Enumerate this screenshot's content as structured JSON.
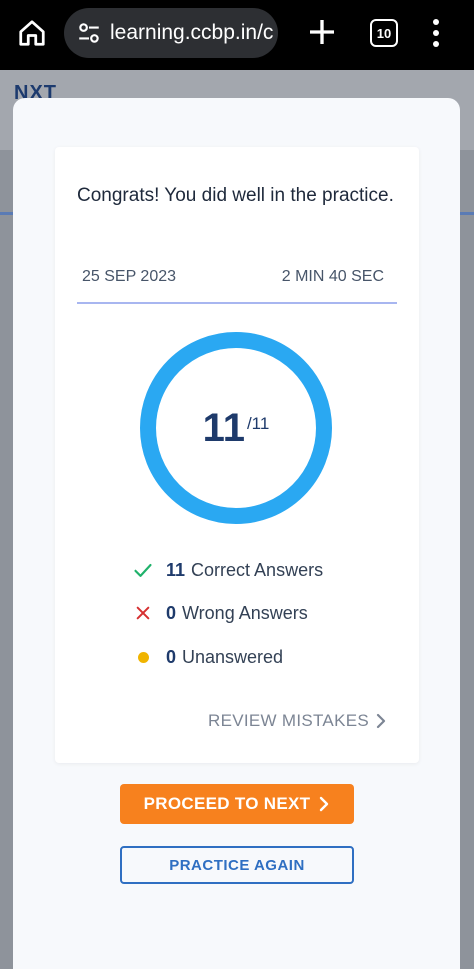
{
  "browser": {
    "url": "learning.ccbp.in/c",
    "tab_count": "10"
  },
  "page": {
    "brand": "NXT"
  },
  "result": {
    "message": "Congrats! You did well in the practice.",
    "date": "25 SEP 2023",
    "duration": "2 MIN 40 SEC",
    "score": "11",
    "total": "/11",
    "score_fraction": 1.0,
    "stats": {
      "correct": {
        "count": "11",
        "label": "Correct Answers"
      },
      "wrong": {
        "count": "0",
        "label": "Wrong Answers"
      },
      "unanswered": {
        "count": "0",
        "label": "Unanswered"
      }
    },
    "review_label": "REVIEW MISTAKES"
  },
  "actions": {
    "proceed_label": "PROCEED TO NEXT",
    "practice_label": "PRACTICE AGAIN"
  },
  "colors": {
    "ring": "#2aa8f2",
    "primary": "#f7811e",
    "outline": "#2f6fc2",
    "correct": "#20b26b",
    "wrong": "#d63031",
    "unanswered": "#f0b400"
  },
  "icons": [
    "home-icon",
    "site-settings-icon",
    "plus-icon",
    "tab-switcher-icon",
    "more-vert-icon",
    "check-icon",
    "cross-icon",
    "dot-icon",
    "chevron-right-icon"
  ]
}
